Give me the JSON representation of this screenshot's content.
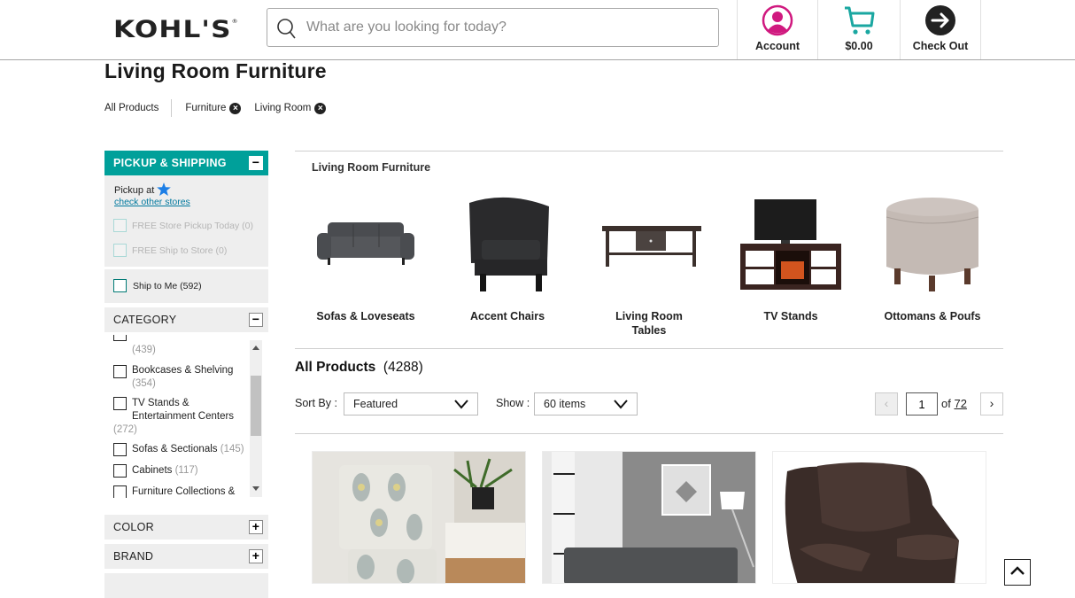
{
  "header": {
    "logo": "KOHL'S",
    "logo_mark": "®",
    "search_placeholder": "What are you looking for today?",
    "search_value": "",
    "account_label": "Account",
    "cart_total": "$0.00",
    "checkout_label": "Check Out",
    "colors": {
      "account": "#d0197f",
      "cart": "#1aa7a1",
      "checkout": "#222222"
    }
  },
  "page": {
    "title": "Living Room Furniture",
    "breadcrumbs": {
      "root": "All Products",
      "chips": [
        "Furniture",
        "Living Room"
      ]
    }
  },
  "sidebar": {
    "pickup": {
      "title": "PICKUP & SHIPPING",
      "toggle": "−",
      "pickup_at": "Pickup at",
      "check_stores": "check other stores",
      "options": [
        {
          "label": "FREE Store Pickup Today (0)",
          "disabled": true
        },
        {
          "label": "FREE Ship to Store (0)",
          "disabled": true
        }
      ],
      "ship_to_me": "Ship to Me (592)"
    },
    "category": {
      "title": "CATEGORY",
      "toggle": "−",
      "items": [
        {
          "label": "",
          "count": "(439)"
        },
        {
          "label": "Bookcases & Shelving",
          "count": "(354)"
        },
        {
          "label": "TV Stands &",
          "label2": "Entertainment Centers",
          "count": "(272)"
        },
        {
          "label": "Sofas & Sectionals",
          "count": "(145)"
        },
        {
          "label": "Cabinets",
          "count": "(117)"
        },
        {
          "label": "Furniture Collections &",
          "count": ""
        }
      ]
    },
    "color": {
      "title": "COLOR",
      "toggle": "+"
    },
    "brand": {
      "title": "BRAND",
      "toggle": "+"
    }
  },
  "main": {
    "subcategory_heading": "Living Room Furniture",
    "subcategories": [
      {
        "name": "Sofas & Loveseats",
        "icon": "sofa-image"
      },
      {
        "name": "Accent Chairs",
        "icon": "accent-chair-image"
      },
      {
        "name": "Living Room",
        "name2": "Tables",
        "icon": "coffee-table-image"
      },
      {
        "name": "TV Stands",
        "icon": "tv-stand-image"
      },
      {
        "name": "Ottomans & Poufs",
        "icon": "ottoman-image"
      }
    ],
    "all_products_label": "All Products",
    "all_products_count": "(4288)",
    "sort_label": "Sort By :",
    "sort_value": "Featured",
    "show_label": "Show :",
    "show_value": "60 items",
    "pager": {
      "prev": "‹",
      "current": "1",
      "of": "of",
      "total": "72",
      "next": "›"
    },
    "products": [
      {
        "image": "patterned-accent-chair-photo"
      },
      {
        "image": "gray-tufted-sofa-photo"
      },
      {
        "image": "brown-leather-recliner-photo"
      }
    ]
  }
}
